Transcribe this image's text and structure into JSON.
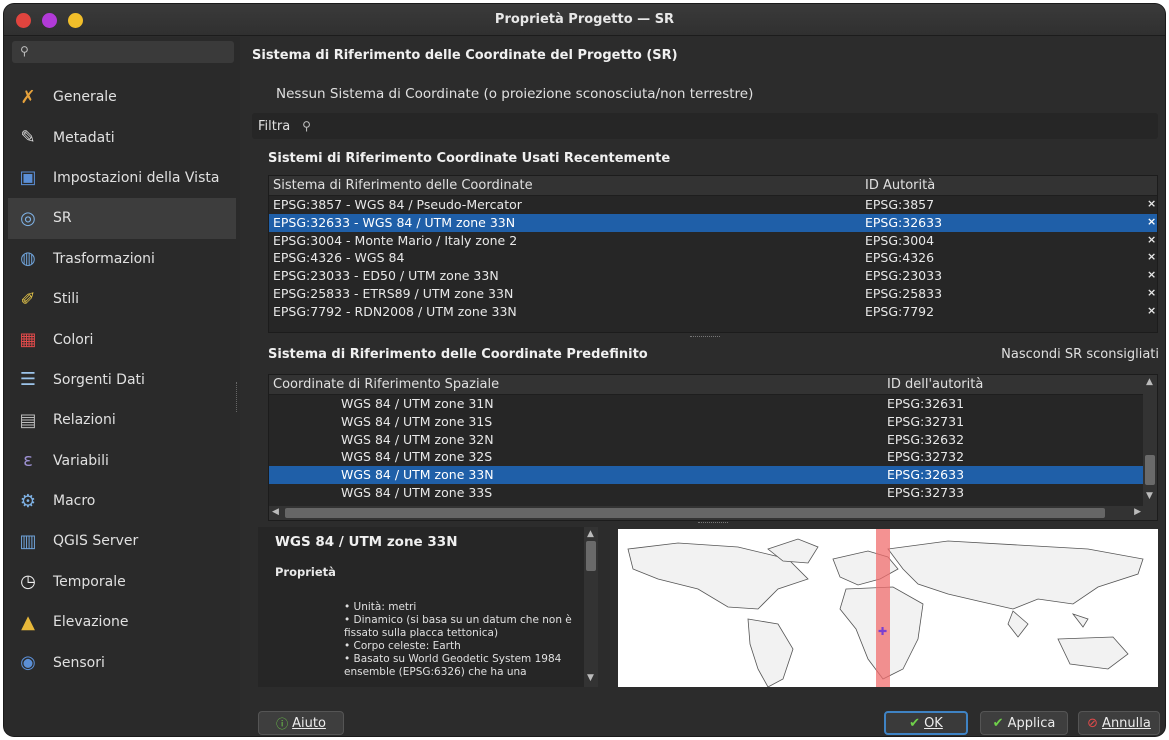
{
  "window": {
    "title": "Proprietà Progetto — SR"
  },
  "sidebar": {
    "search_icon": "search-icon",
    "items": [
      {
        "label": "Generale",
        "icon": "tools-icon",
        "color": "#e6a23c"
      },
      {
        "label": "Metadati",
        "icon": "document-edit-icon",
        "color": "#d9d9d9"
      },
      {
        "label": "Impostazioni della Vista",
        "icon": "map-view-icon",
        "color": "#5b8fd6"
      },
      {
        "label": "SR",
        "icon": "globe-icon",
        "color": "#7fb2e5",
        "selected": true
      },
      {
        "label": "Trasformazioni",
        "icon": "globe-transform-icon",
        "color": "#6fa2d8"
      },
      {
        "label": "Stili",
        "icon": "brush-icon",
        "color": "#e8c84a"
      },
      {
        "label": "Colori",
        "icon": "palette-icon",
        "color": "#e04a4a"
      },
      {
        "label": "Sorgenti Dati",
        "icon": "data-source-icon",
        "color": "#9cc4ea"
      },
      {
        "label": "Relazioni",
        "icon": "relations-icon",
        "color": "#bbbbbb"
      },
      {
        "label": "Variabili",
        "icon": "variables-icon",
        "color": "#9b8fcf"
      },
      {
        "label": "Macro",
        "icon": "gear-icon",
        "color": "#7fb2e5"
      },
      {
        "label": "QGIS Server",
        "icon": "server-icon",
        "color": "#6fa2d8"
      },
      {
        "label": "Temporale",
        "icon": "clock-icon",
        "color": "#eeeeee"
      },
      {
        "label": "Elevazione",
        "icon": "elevation-icon",
        "color": "#e8b83a"
      },
      {
        "label": "Sensori",
        "icon": "sensor-icon",
        "color": "#5b8fd6"
      }
    ]
  },
  "main": {
    "title": "Sistema di Riferimento delle Coordinate del Progetto (SR)",
    "no_crs_label": "Nessun Sistema di Coordinate (o proiezione sconosciuta/non terrestre)",
    "filter_label": "Filtra",
    "filter_placeholder": "",
    "recent_title": "Sistemi di Riferimento Coordinate Usati Recentemente",
    "recent_headers": [
      "Sistema di Riferimento delle Coordinate",
      "ID Autorità"
    ],
    "recent_rows": [
      {
        "name": "EPSG:3857 - WGS 84 / Pseudo-Mercator",
        "id": "EPSG:3857",
        "remove": "×"
      },
      {
        "name": "EPSG:32633 - WGS 84 / UTM zone 33N",
        "id": "EPSG:32633",
        "remove": "×",
        "selected": true
      },
      {
        "name": "EPSG:3004 - Monte Mario / Italy zone 2",
        "id": "EPSG:3004",
        "remove": "×"
      },
      {
        "name": "EPSG:4326 - WGS 84",
        "id": "EPSG:4326",
        "remove": "×"
      },
      {
        "name": "EPSG:23033 - ED50 / UTM zone 33N",
        "id": "EPSG:23033",
        "remove": "×"
      },
      {
        "name": "EPSG:25833 - ETRS89 / UTM zone 33N",
        "id": "EPSG:25833",
        "remove": "×"
      },
      {
        "name": "EPSG:7792 - RDN2008 / UTM zone 33N",
        "id": "EPSG:7792",
        "remove": "×"
      }
    ],
    "predefined_title": "Sistema di Riferimento delle Coordinate Predefinito",
    "hide_deprecated": "Nascondi SR sconsigliati",
    "predefined_headers": [
      "Coordinate di Riferimento Spaziale",
      "ID dell'autorità"
    ],
    "predefined_rows": [
      {
        "name": "WGS 84 / UTM zone 31N",
        "id": "EPSG:32631"
      },
      {
        "name": "WGS 84 / UTM zone 31S",
        "id": "EPSG:32731"
      },
      {
        "name": "WGS 84 / UTM zone 32N",
        "id": "EPSG:32632"
      },
      {
        "name": "WGS 84 / UTM zone 32S",
        "id": "EPSG:32732"
      },
      {
        "name": "WGS 84 / UTM zone 33N",
        "id": "EPSG:32633",
        "selected": true
      },
      {
        "name": "WGS 84 / UTM zone 33S",
        "id": "EPSG:32733"
      }
    ]
  },
  "details": {
    "title": "WGS 84 / UTM zone 33N",
    "properties_label": "Proprietà",
    "items": [
      "Unità: metri",
      "Dinamico (si basa su un datum che non è fissato sulla placca tettonica)",
      "Corpo celeste: Earth",
      "Basato su World Geodetic System 1984 ensemble (EPSG:6326) che ha una"
    ]
  },
  "buttons": {
    "help": "Aiuto",
    "ok": "OK",
    "apply": "Applica",
    "cancel": "Annulla"
  },
  "colors": {
    "selection": "#1f5fa8",
    "ok_border": "#3f83c4",
    "band": "#f06e6e"
  }
}
